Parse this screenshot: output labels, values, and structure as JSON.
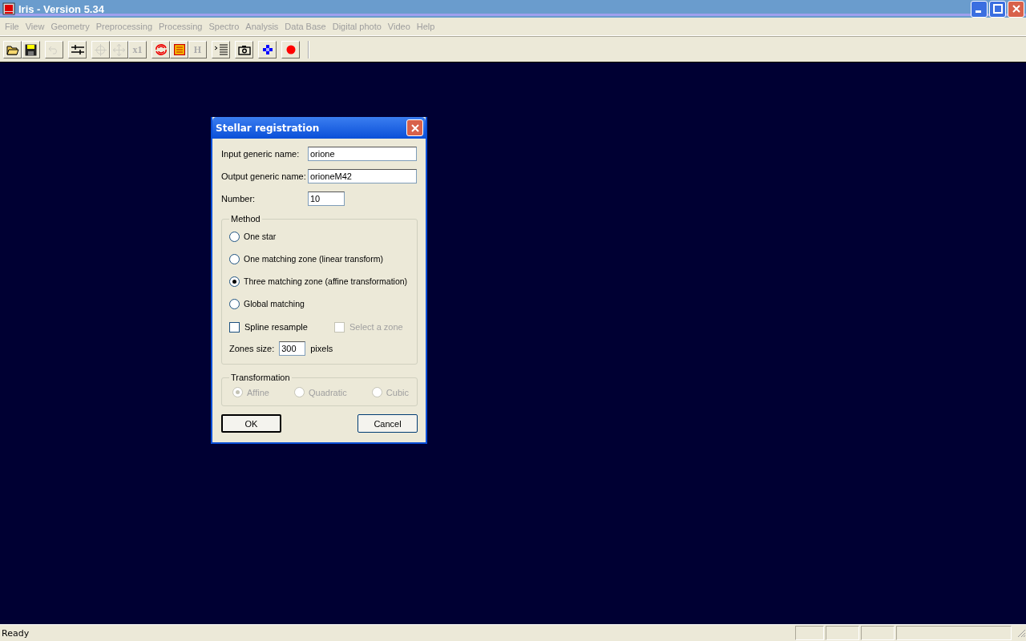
{
  "window": {
    "title": "Iris - Version 5.34"
  },
  "menu": [
    {
      "label": "File",
      "disabled": true
    },
    {
      "label": "View",
      "disabled": true
    },
    {
      "label": "Geometry",
      "disabled": true
    },
    {
      "label": "Preprocessing",
      "disabled": true
    },
    {
      "label": "Processing",
      "disabled": true
    },
    {
      "label": "Spectro",
      "disabled": true
    },
    {
      "label": "Analysis",
      "disabled": true
    },
    {
      "label": "Data Base",
      "disabled": true
    },
    {
      "label": "Digital photo",
      "disabled": true
    },
    {
      "label": "Video",
      "disabled": true
    },
    {
      "label": "Help",
      "disabled": true
    }
  ],
  "toolbar": [
    [
      {
        "kind": "open",
        "disabled": false
      },
      {
        "kind": "save",
        "disabled": false
      }
    ],
    [
      {
        "kind": "undo",
        "disabled": true
      }
    ],
    [
      {
        "kind": "sliders",
        "disabled": false
      }
    ],
    [
      {
        "kind": "target",
        "disabled": true
      },
      {
        "kind": "move",
        "disabled": true
      },
      {
        "kind": "text",
        "label": "x1",
        "disabled": true
      }
    ],
    [
      {
        "kind": "swirl",
        "disabled": false
      },
      {
        "kind": "lines",
        "disabled": false
      },
      {
        "kind": "text",
        "label": "H",
        "disabled": true
      }
    ],
    [
      {
        "kind": "list",
        "disabled": false
      }
    ],
    [
      {
        "kind": "camera",
        "disabled": false
      }
    ],
    [
      {
        "kind": "diamond",
        "disabled": false
      }
    ],
    [
      {
        "kind": "dot",
        "disabled": false
      }
    ]
  ],
  "dialog": {
    "title": "Stellar registration",
    "fields": [
      {
        "label": "Input generic name:",
        "value": "orione",
        "kind": "wide"
      },
      {
        "label": "Output generic name:",
        "value": "orioneM42",
        "kind": "wide"
      },
      {
        "label": "Number:",
        "value": "10",
        "kind": "short"
      }
    ],
    "method": {
      "legend": "Method",
      "options": [
        {
          "label": "One star",
          "selected": false
        },
        {
          "label": "One matching zone (linear transform)",
          "selected": false
        },
        {
          "label": "Three matching zone (affine transformation)",
          "selected": true
        },
        {
          "label": "Global matching",
          "selected": false
        }
      ],
      "checks": [
        {
          "label": "Spline resample",
          "checked": false,
          "disabled": false
        },
        {
          "label": "Select a zone",
          "checked": false,
          "disabled": true
        }
      ],
      "zones_size": {
        "label": "Zones size:",
        "value": "300",
        "unit": "pixels"
      }
    },
    "transformation": {
      "legend": "Transformation",
      "disabled": true,
      "options": [
        {
          "label": "Affine",
          "selected": true
        },
        {
          "label": "Quadratic",
          "selected": false
        },
        {
          "label": "Cubic",
          "selected": false
        }
      ]
    },
    "buttons": [
      "OK",
      "Cancel"
    ]
  },
  "status_bar": {
    "text": "Ready"
  }
}
